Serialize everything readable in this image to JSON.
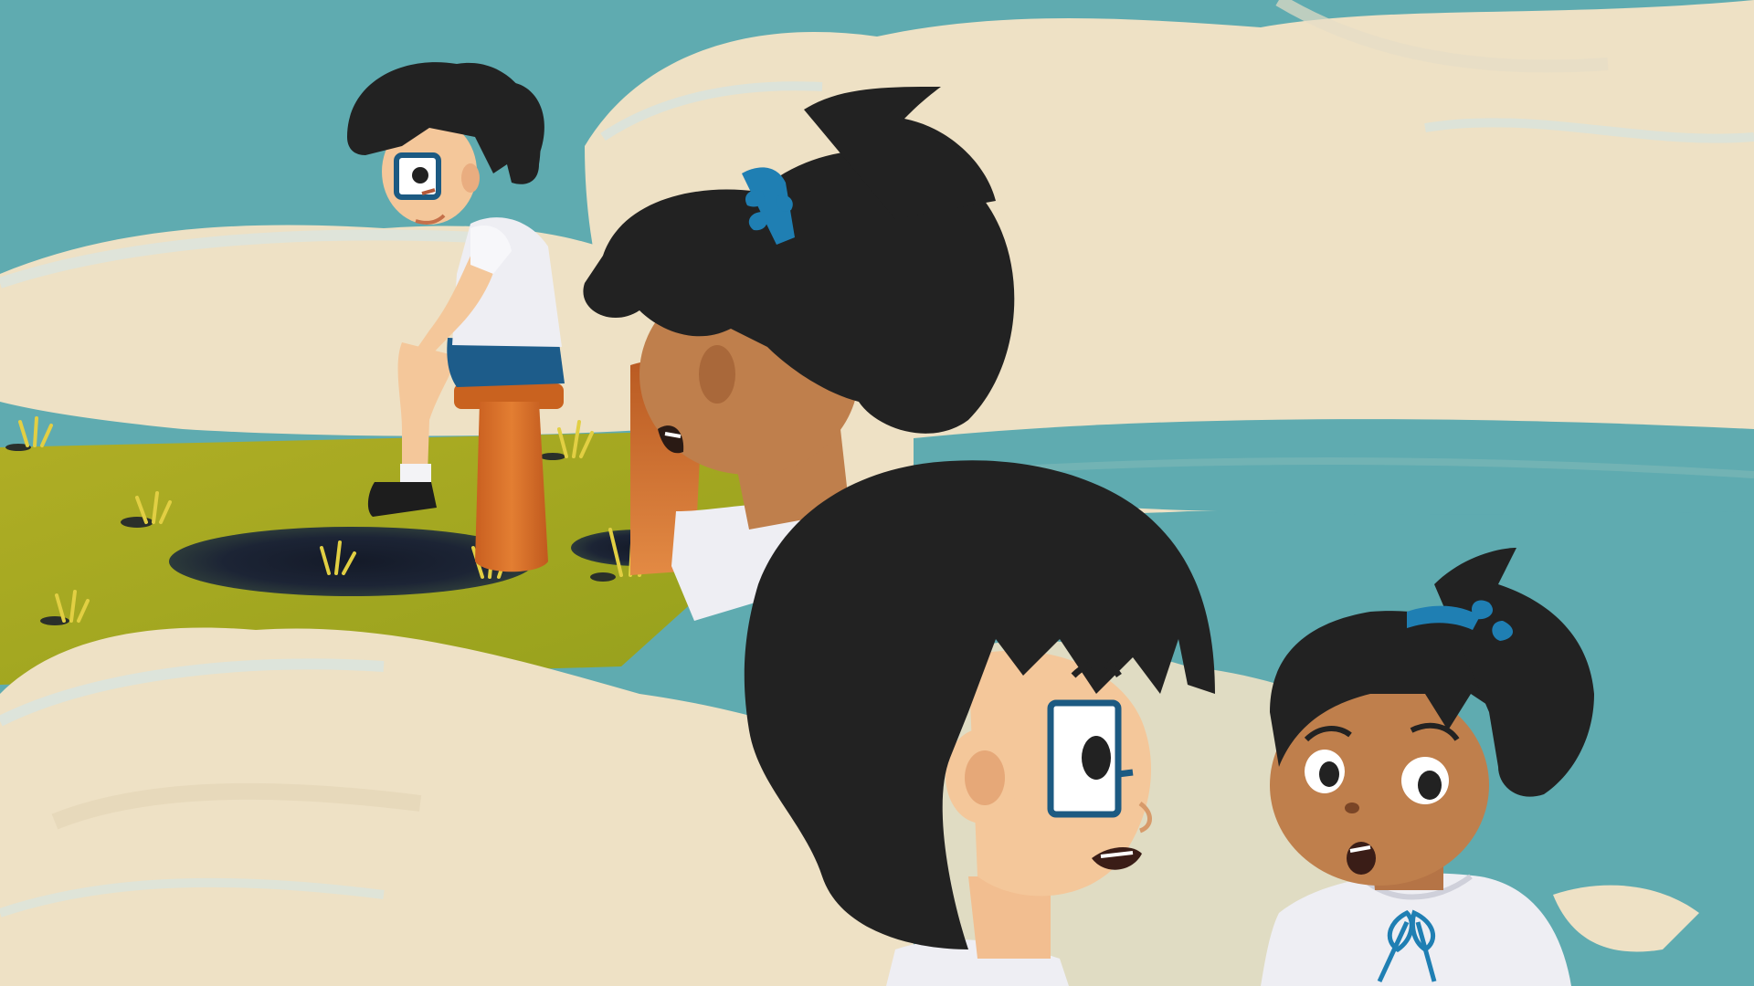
{
  "scene": {
    "style": "flat cartoon illustration",
    "colors": {
      "sky": "#5fabb0",
      "cloud": "#eee1c5",
      "cloud_shade": "#e3d3b4",
      "grass": "#a8aa22",
      "grass_dark": "#8c9219",
      "hole": "#1c2435",
      "hair": "#222222",
      "skin_light": "#f4c79a",
      "skin_dark": "#bf7f4c",
      "shirt": "#eeeef3",
      "shorts": "#1d5c8a",
      "stool": "#d6702a",
      "glasses": "#1c5a82",
      "ribbon": "#1f7fb3"
    }
  }
}
